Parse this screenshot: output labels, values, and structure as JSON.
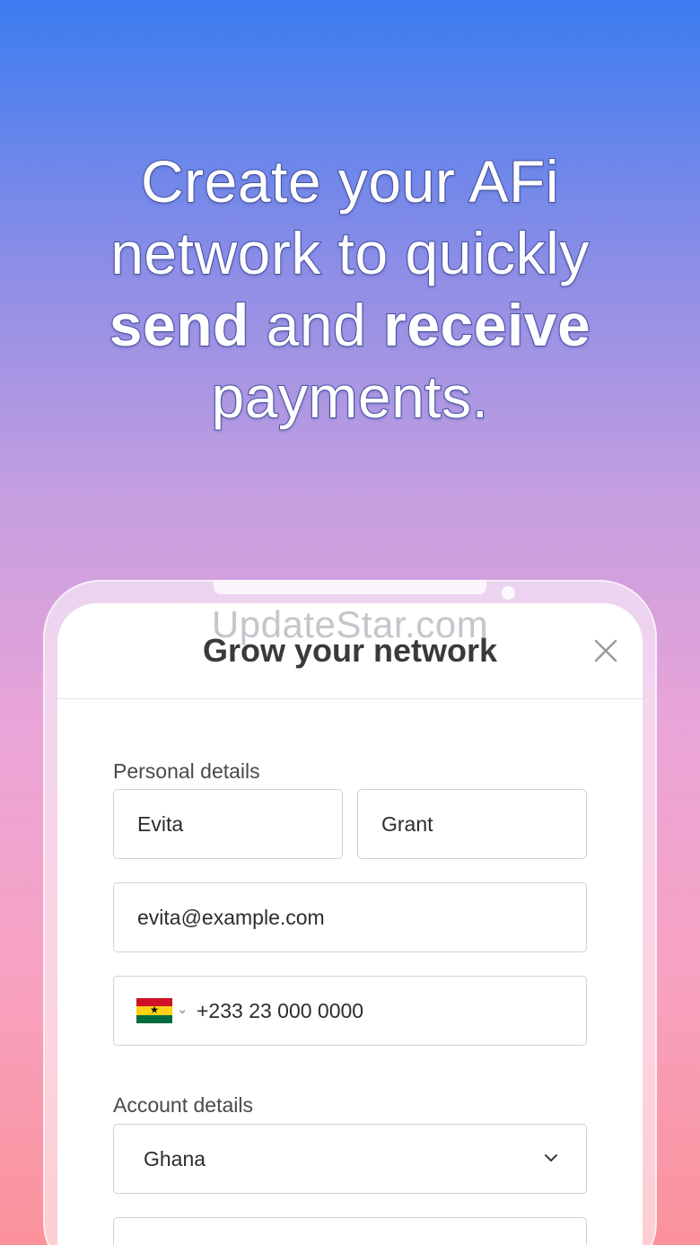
{
  "promo": {
    "line1": "Create your AFi",
    "line2": "network to quickly",
    "line3_bold1": "send",
    "line3_mid": " and ",
    "line3_bold2": "receive",
    "line4": "payments."
  },
  "watermark": "UpdateStar.com",
  "modal": {
    "title": "Grow your network",
    "close_icon": "close-icon"
  },
  "personal": {
    "section_label": "Personal details",
    "first_name": "Evita",
    "last_name": "Grant",
    "email": "evita@example.com",
    "phone_country_icon": "ghana-flag-icon",
    "phone": "+233 23 000 0000"
  },
  "account": {
    "section_label": "Account details",
    "country": "Ghana",
    "country_chevron_icon": "chevron-down-icon"
  },
  "colors": {
    "gradient_top": "#3b7cf0",
    "gradient_bottom": "#fb929a",
    "text_outline": "#4a57a8"
  }
}
